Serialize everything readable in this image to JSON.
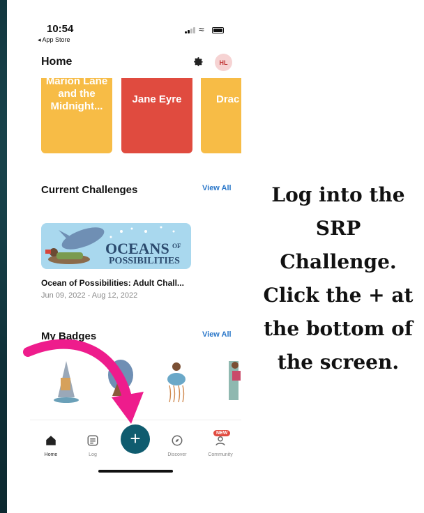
{
  "status_bar": {
    "time": "10:54",
    "back_label": "◂ App Store"
  },
  "header": {
    "title": "Home",
    "avatar_initials": "HL"
  },
  "books": [
    {
      "title": "Marion Lane and the Midnight...",
      "color": "#f7bc46"
    },
    {
      "title": "Jane Eyre",
      "color": "#e04b3f"
    },
    {
      "title": "Drac",
      "color": "#f7bc46"
    }
  ],
  "challenges": {
    "section_title": "Current Challenges",
    "view_all": "View All",
    "banner_text_line1": "OCEANS",
    "banner_text_of": "OF",
    "banner_text_line2": "POSSIBILITIES",
    "name": "Ocean of Possibilities: Adult Chall...",
    "dates": "Jun 09, 2022 - Aug 12, 2022"
  },
  "badges": {
    "section_title": "My Badges",
    "view_all": "View All"
  },
  "tabbar": {
    "home": "Home",
    "log": "Log",
    "add": "+",
    "discover": "Discover",
    "community": "Community",
    "community_badge": "NEW"
  },
  "instructions": {
    "lines": [
      "Log into the",
      "SRP",
      "Challenge.",
      "Click the + at",
      "the bottom of",
      "the screen."
    ]
  },
  "colors": {
    "accent": "#0f5c6f",
    "link": "#2a77c9",
    "arrow": "#ee1c8c",
    "background": "#0f3038"
  }
}
